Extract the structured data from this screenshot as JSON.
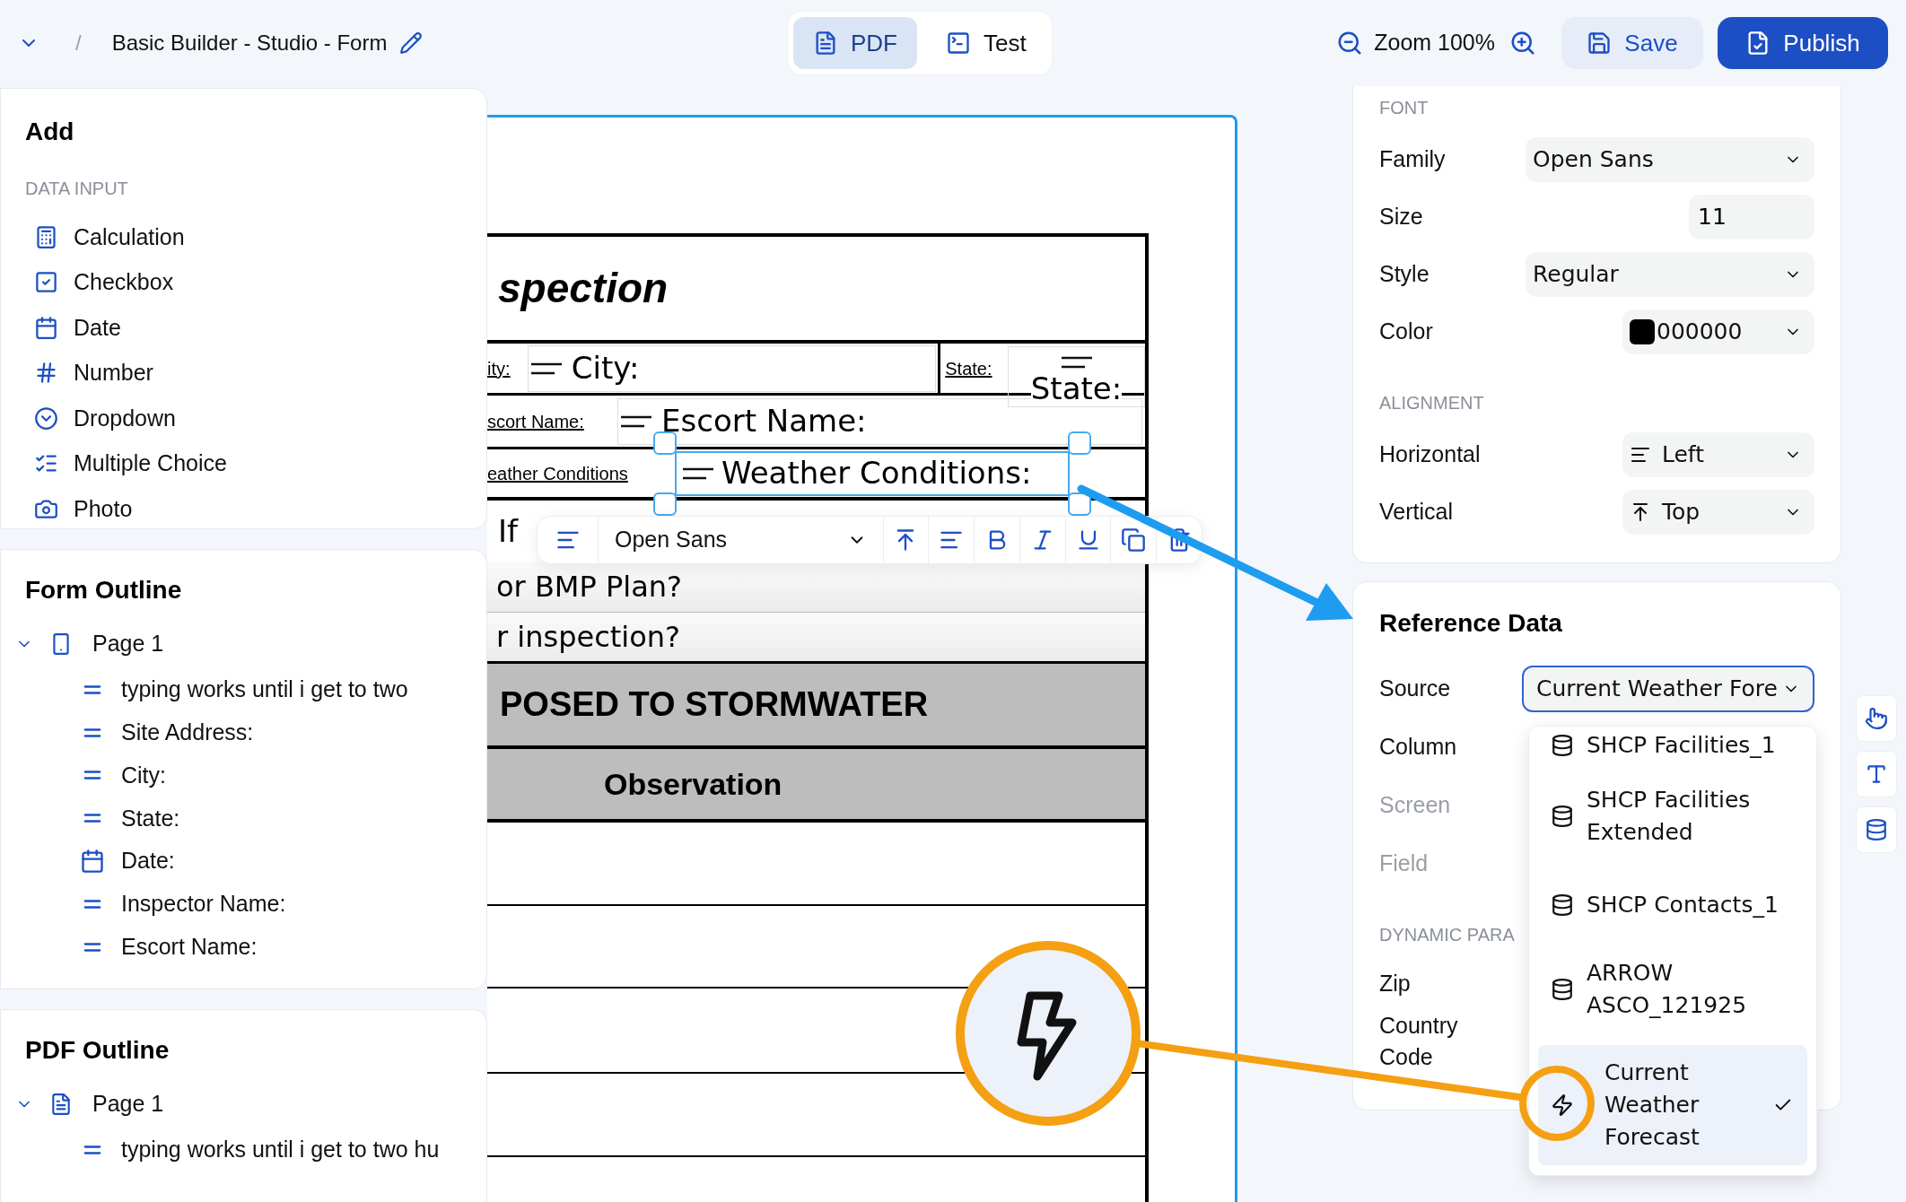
{
  "top_bar": {
    "separator": "/",
    "title": "Basic Builder - Studio - Form",
    "mode_tabs": [
      {
        "label": "PDF",
        "kind": "pdf",
        "selected": true
      },
      {
        "label": "Test",
        "kind": "test",
        "selected": false
      }
    ],
    "zoom": "Zoom 100%",
    "buttons": [
      {
        "label": "Save",
        "kind": "secondary"
      },
      {
        "label": "Publish",
        "kind": "primary"
      }
    ]
  },
  "add_panel": {
    "title": "Add",
    "section": "DATA INPUT",
    "items": [
      {
        "label": "Calculation",
        "kind": "calculator"
      },
      {
        "label": "Checkbox",
        "kind": "checkbox"
      },
      {
        "label": "Date",
        "kind": "date"
      },
      {
        "label": "Number",
        "kind": "number"
      },
      {
        "label": "Dropdown",
        "kind": "dropdown"
      },
      {
        "label": "Multiple Choice",
        "kind": "multiple_choice"
      },
      {
        "label": "Photo",
        "kind": "photo"
      }
    ]
  },
  "form_outline": {
    "title": "Form Outline",
    "pages": [
      {
        "label": "Page 1",
        "expanded": true,
        "children": [
          {
            "label": "typing works until i get to two",
            "kind": "text"
          },
          {
            "label": "Site Address:",
            "kind": "text"
          },
          {
            "label": "City:",
            "kind": "text"
          },
          {
            "label": "State:",
            "kind": "text"
          },
          {
            "label": "Date:",
            "kind": "date"
          },
          {
            "label": "Inspector Name:",
            "kind": "text"
          },
          {
            "label": "Escort Name:",
            "kind": "text"
          }
        ]
      }
    ]
  },
  "pdf_outline": {
    "title": "PDF Outline",
    "pages": [
      {
        "label": "Page 1",
        "expanded": true,
        "children": [
          {
            "label": "typing works until i get to two hu",
            "kind": "text"
          }
        ]
      }
    ]
  },
  "document": {
    "heading": "spection",
    "city_label": "ity:",
    "city_field": "City:",
    "state_label": "State:",
    "state_field": "State:",
    "escort_label": "scort Name:",
    "escort_field": "Escort Name:",
    "weather_label": "eather Conditions",
    "weather_field": {
      "value": "Weather Conditions:",
      "selected": true
    },
    "if_fragment": "If",
    "bmp_question": "or BMP Plan?",
    "inspection_question": "r inspection?",
    "section_heading": "POSED TO STORMWATER",
    "column_heading": "Observation"
  },
  "text_toolbar": {
    "font": "Open Sans"
  },
  "font_panel": {
    "section": "FONT",
    "family": {
      "label": "Family",
      "value": "Open Sans"
    },
    "size": {
      "label": "Size",
      "value": "11"
    },
    "style": {
      "label": "Style",
      "value": "Regular"
    },
    "color": {
      "label": "Color",
      "value": "000000",
      "color": "#000000"
    },
    "alignment_section": "ALIGNMENT",
    "horizontal": {
      "label": "Horizontal",
      "value": "Left"
    },
    "vertical": {
      "label": "Vertical",
      "value": "Top"
    }
  },
  "reference_data": {
    "title": "Reference Data",
    "fields": [
      {
        "label": "Source",
        "disabled": false
      },
      {
        "label": "Column",
        "disabled": false
      },
      {
        "label": "Screen",
        "disabled": true
      },
      {
        "label": "Field",
        "disabled": true
      }
    ],
    "source_value": "Current Weather Fore",
    "dynamic_section": "DYNAMIC PARA",
    "params": [
      {
        "label": "Zip"
      },
      {
        "label": "Country Code"
      }
    ],
    "options": [
      {
        "label": "SHCP Facilities_1",
        "kind": "table",
        "selected": false
      },
      {
        "label": "SHCP Facilities Extended",
        "kind": "table",
        "selected": false
      },
      {
        "label": "SHCP Contacts_1",
        "kind": "table",
        "selected": false
      },
      {
        "label": "ARROW ASCO_121925",
        "kind": "table",
        "selected": false
      },
      {
        "label": "Current Weather Forecast",
        "kind": "api",
        "selected": true
      }
    ]
  }
}
